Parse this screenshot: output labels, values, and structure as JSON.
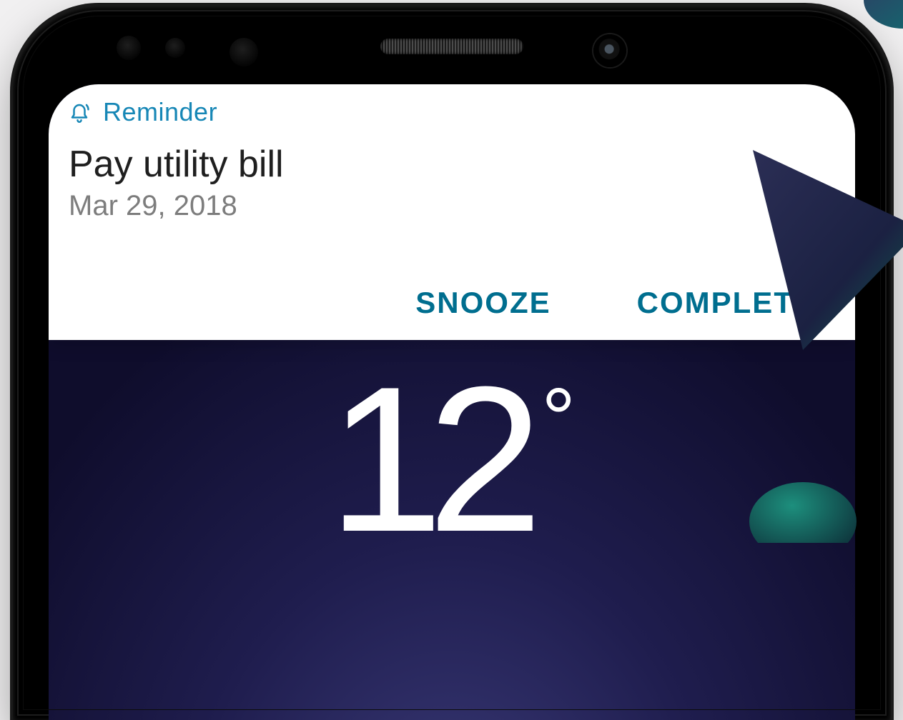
{
  "notification": {
    "app_label": "Reminder",
    "title": "Pay utility bill",
    "date": "Mar 29, 2018",
    "actions": {
      "snooze": "SNOOZE",
      "complete": "COMPLETE"
    }
  },
  "lockscreen": {
    "temperature_value": "12",
    "temperature_unit": "°"
  },
  "icons": {
    "reminder": "bell-icon"
  },
  "colors": {
    "accent": "#1787b6",
    "action": "#006e8f",
    "page_bg": "#f1f0f1",
    "card_bg": "#ffffff"
  }
}
